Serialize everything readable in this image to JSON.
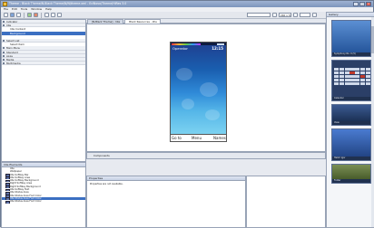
{
  "window": {
    "title": "Theme - Black Theme/N-Black Theme/N/N/theme.xml - EciNovo/Theme/HiRes 3.0"
  },
  "menu": [
    "File",
    "Edit",
    "Tools",
    "Window",
    "Help"
  ],
  "toolbar": {
    "theme_combo": "",
    "res_combo": "240 x 320",
    "zoom_combo": ""
  },
  "navigator": {
    "items": [
      {
        "label": "Indicator",
        "kind": "hdr"
      },
      {
        "label": "Idle",
        "kind": "hdr"
      },
      {
        "label": "Idle Context",
        "kind": "sub"
      },
      {
        "label": "Background",
        "kind": "sub",
        "selected": true
      },
      {
        "label": "",
        "kind": "sub"
      },
      {
        "label": "Select List",
        "kind": "hdr"
      },
      {
        "label": "Select Item",
        "kind": "sub"
      },
      {
        "label": "Main Menu",
        "kind": "hdr"
      },
      {
        "label": "Standard",
        "kind": "hdr"
      },
      {
        "label": "Apps",
        "kind": "hdr"
      },
      {
        "label": "Media",
        "kind": "hdr"
      },
      {
        "label": "Multimedia",
        "kind": "hdr"
      }
    ]
  },
  "inspector": {
    "tab": "Idle Elements",
    "items": [
      {
        "label": "Idle",
        "swatch": false
      },
      {
        "label": "Wallpaper",
        "swatch": false
      },
      {
        "label": "Idle Softkey Bar",
        "swatch": true
      },
      {
        "label": "Idle Softkey Area",
        "swatch": true
      },
      {
        "label": "Idle Softkey Background",
        "swatch": true
      },
      {
        "label": "Right Softkey Area",
        "swatch": true
      },
      {
        "label": "Right Softkey Background",
        "swatch": true
      },
      {
        "label": "Idle Softkey Text",
        "swatch": true
      },
      {
        "label": "Idle Status Area",
        "swatch": true
      },
      {
        "label": "Idle Status Area Font Color",
        "swatch": true
      },
      {
        "label": "Idle Status Area Font Color",
        "swatch": true,
        "selected": true
      },
      {
        "label": "Idle Status Area Font Color",
        "swatch": true
      }
    ]
  },
  "editor": {
    "tabs": [
      {
        "label": "[N-Black Theme] - Idle",
        "active": false
      },
      {
        "label": "Black Resources - Idle",
        "active": true
      }
    ],
    "phone": {
      "operator": "Operator",
      "clock": "12:15",
      "soft_left": "Go to",
      "soft_center": "Menu",
      "soft_right": "Names"
    }
  },
  "components": {
    "label": "Components"
  },
  "properties": {
    "tab": "Properties",
    "message": "Properties are not available."
  },
  "palette": {
    "tab": "Gallery",
    "items": [
      {
        "caption": "Symphony No. 9 (5)",
        "bg": "#3a6fb5"
      },
      {
        "caption": "Calendar",
        "bg": "#2b3f67"
      },
      {
        "caption": "View",
        "bg": "#1e3560"
      },
      {
        "caption": "Hello! Igor",
        "bg": "#274d8c"
      },
      {
        "caption": "Folder",
        "bg": "#5a6f39"
      }
    ]
  },
  "colors": {
    "selection": "#3b6fc2",
    "title_bg": "#7d95bc"
  }
}
